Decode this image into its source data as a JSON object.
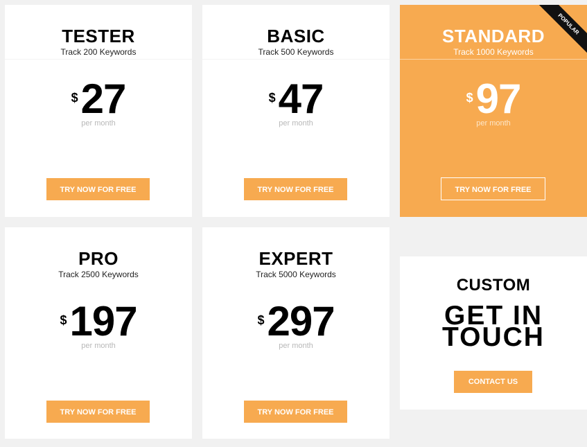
{
  "colors": {
    "accent": "#f7aa50",
    "background": "#f1f1f1"
  },
  "plans": [
    {
      "name": "TESTER",
      "keywords": "Track 200 Keywords",
      "currency": "$",
      "price": "27",
      "period": "per month",
      "cta": "TRY NOW FOR FREE"
    },
    {
      "name": "BASIC",
      "keywords": "Track 500 Keywords",
      "currency": "$",
      "price": "47",
      "period": "per month",
      "cta": "TRY NOW FOR FREE"
    },
    {
      "name": "STANDARD",
      "keywords": "Track 1000 Keywords",
      "currency": "$",
      "price": "97",
      "period": "per month",
      "cta": "TRY NOW FOR FREE",
      "badge": "POPULAR"
    },
    {
      "name": "PRO",
      "keywords": "Track 2500 Keywords",
      "currency": "$",
      "price": "197",
      "period": "per month",
      "cta": "TRY NOW FOR FREE"
    },
    {
      "name": "EXPERT",
      "keywords": "Track 5000 Keywords",
      "currency": "$",
      "price": "297",
      "period": "per month",
      "cta": "TRY NOW FOR FREE"
    }
  ],
  "custom": {
    "name": "CUSTOM",
    "headline_line1": "GET IN",
    "headline_line2": "TOUCH",
    "cta": "CONTACT US"
  }
}
